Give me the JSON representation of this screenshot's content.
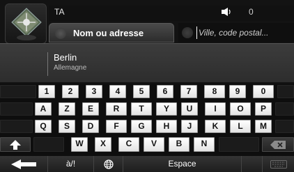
{
  "status": {
    "title": "TA",
    "volume_icon": "speaker-icon",
    "count": "0"
  },
  "home": {
    "icon": "map-compass-icon"
  },
  "tabs": {
    "name_label": "Nom ou adresse",
    "city_placeholder": "Ville, code postal..."
  },
  "suggestion": {
    "city": "Berlin",
    "country": "Allemagne"
  },
  "keyboard": {
    "row1": [
      "1",
      "2",
      "3",
      "4",
      "5",
      "6",
      "7",
      "8",
      "9",
      "0"
    ],
    "row2": [
      "A",
      "Z",
      "E",
      "R",
      "T",
      "Y",
      "U",
      "I",
      "O",
      "P"
    ],
    "row3": [
      "Q",
      "S",
      "D",
      "F",
      "G",
      "H",
      "J",
      "K",
      "L",
      "M"
    ],
    "row4": [
      "W",
      "X",
      "C",
      "V",
      "B",
      "N"
    ],
    "shift_icon": "shift-arrow-icon",
    "backspace_icon": "backspace-icon",
    "bottom": {
      "back_icon": "back-arrow-icon",
      "symbols_label": "à/!",
      "globe_icon": "globe-icon",
      "space_label": "Espace",
      "keyboard_icon": "keyboard-icon"
    }
  }
}
